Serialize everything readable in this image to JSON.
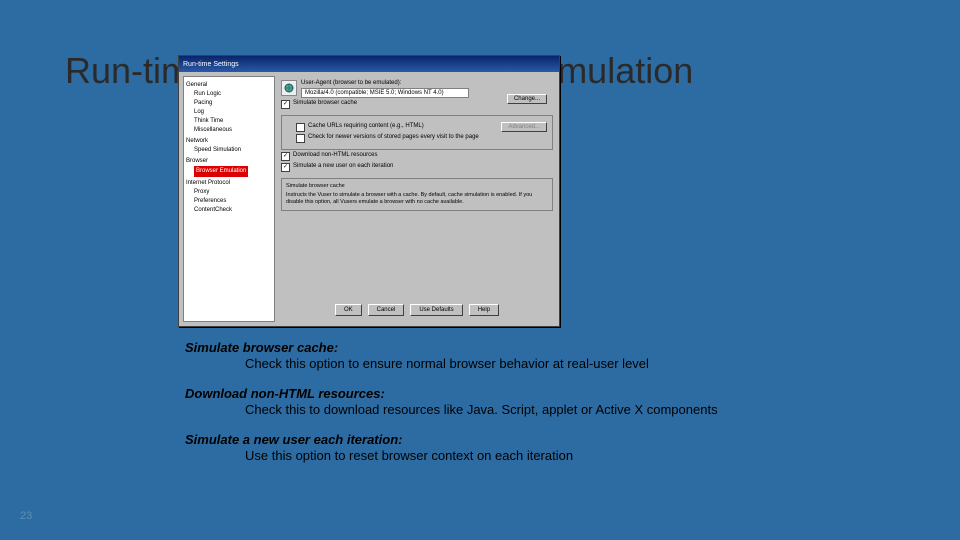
{
  "slide": {
    "title": "Run-time Settings – Browser Emulation",
    "page": "23"
  },
  "dialog": {
    "title": "Run-time Settings",
    "tree": {
      "g1": "General",
      "g1a": "Run Logic",
      "g1b": "Pacing",
      "g1c": "Log",
      "g1d": "Think Time",
      "g1e": "Miscellaneous",
      "g2": "Network",
      "g2a": "Speed Simulation",
      "g3": "Browser",
      "g3a": "Browser Emulation",
      "g4": "Internet Protocol",
      "g4a": "Proxy",
      "g4b": "Preferences",
      "g4c": "ContentCheck"
    },
    "panel": {
      "ua_label": "User-Agent (browser to be emulated):",
      "ua_value": "Mozilla/4.0 (compatible; MSIE 5.0; Windows NT 4.0)",
      "change": "Change...",
      "cb_sim": "Simulate browser cache",
      "cb_cache_url": "Cache URLs requiring content (e.g., HTML)",
      "cb_check_new": "Check for newer versions of stored pages every visit to the page",
      "advanced": "Advanced...",
      "cb_dl": "Download non-HTML resources",
      "cb_newuser": "Simulate a new user on each iteration",
      "desc_h": "Simulate browser cache",
      "desc_b": "Instructs the Vuser to simulate a browser with a cache. By default, cache simulation is enabled. If you disable this option, all Vusers emulate a browser with no cache available."
    },
    "buttons": {
      "ok": "OK",
      "cancel": "Cancel",
      "def": "Use Defaults",
      "help": "Help"
    }
  },
  "notes": {
    "n1h": "Simulate browser cache:",
    "n1b": "Check this option to ensure normal browser behavior at real-user level",
    "n2h": "Download non-HTML resources:",
    "n2b": "Check this to download resources like Java. Script, applet or Active X components",
    "n3h": "Simulate a new user each iteration:",
    "n3b": "Use this option to reset browser context on each iteration"
  }
}
